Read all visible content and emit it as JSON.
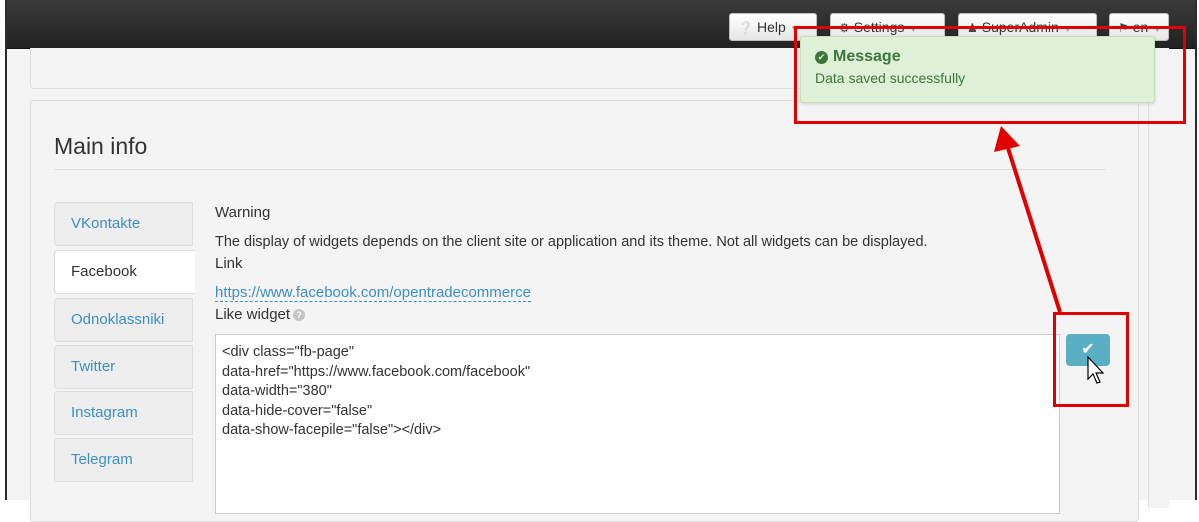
{
  "navbar": {
    "help_label": "Help",
    "settings_label": "Settings",
    "user_label": "SuperAdmin",
    "lang_label": "en"
  },
  "main": {
    "title": "Main info",
    "tabs": [
      {
        "label": "VKontakte",
        "active": false
      },
      {
        "label": "Facebook",
        "active": true
      },
      {
        "label": "Odnoklassniki",
        "active": false
      },
      {
        "label": "Twitter",
        "active": false
      },
      {
        "label": "Instagram",
        "active": false
      },
      {
        "label": "Telegram",
        "active": false
      }
    ],
    "warning_label": "Warning",
    "warning_text": "The display of widgets depends on the client site or application and its theme. Not all widgets can be displayed.",
    "link_label": "Link",
    "link_url": "https://www.facebook.com/opentradecommerce",
    "like_widget_label": "Like widget",
    "code_lines": [
      "<div class=\"fb-page\"",
      "data-href=\"https://www.facebook.com/facebook\"",
      "data-width=\"380\"",
      "data-hide-cover=\"false\"",
      "data-show-facepile=\"false\"></div>"
    ]
  },
  "toast": {
    "title": "Message",
    "text": "Data saved successfully"
  },
  "colors": {
    "navbar": "#2b2b2b",
    "link": "#3a8fc7",
    "save_button": "#5bafc4",
    "toast_bg": "#dff0d8",
    "toast_text": "#3c763d",
    "annotation": "#e00000"
  },
  "icons": {
    "help": "question-circle-icon",
    "settings": "cogs-icon",
    "user": "user-icon",
    "lang": "flag-icon",
    "save": "check-icon",
    "toast": "check-circle-icon"
  }
}
